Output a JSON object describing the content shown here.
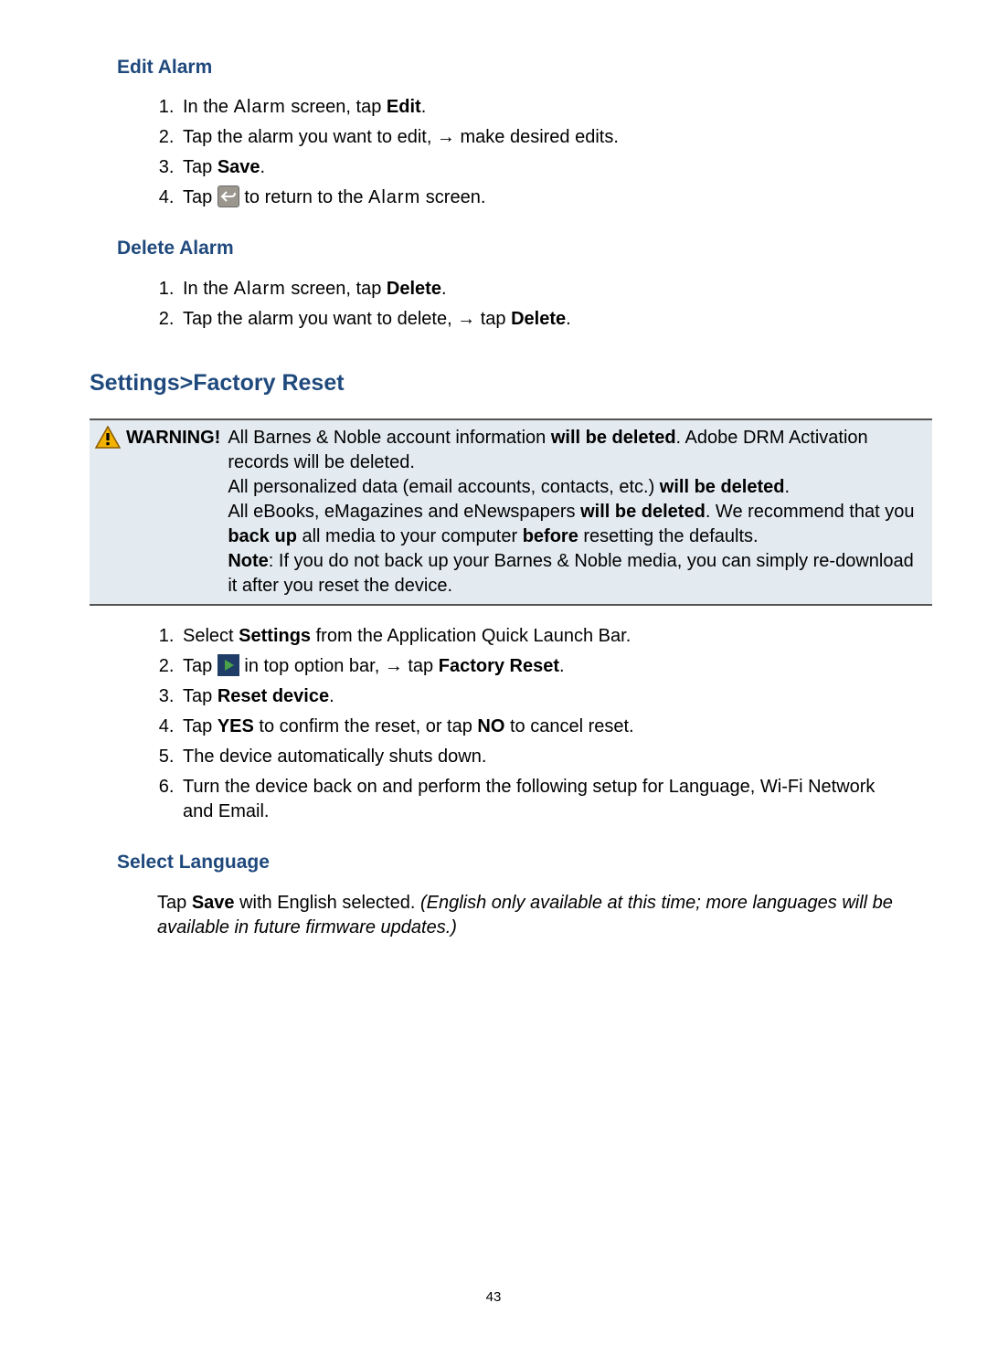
{
  "headings": {
    "editAlarm": "Edit Alarm",
    "deleteAlarm": "Delete Alarm",
    "factoryReset": "Settings>Factory Reset",
    "selectLanguage": "Select Language"
  },
  "editAlarmSteps": {
    "s1_a": "In the ",
    "s1_b": "Alarm",
    "s1_c": " screen, tap ",
    "s1_d": "Edit",
    "s1_e": ".",
    "s2": "Tap the alarm you want to edit, → make desired edits.",
    "s3_a": "Tap ",
    "s3_b": "Save",
    "s3_c": ".",
    "s4_a": "Tap ",
    "s4_b": " to return to the ",
    "s4_c": "Alarm",
    "s4_d": " screen."
  },
  "deleteAlarmSteps": {
    "s1_a": "In the ",
    "s1_b": "Alarm",
    "s1_c": " screen, tap ",
    "s1_d": "Delete",
    "s1_e": ".",
    "s2_a": "Tap the alarm you want to delete, → tap ",
    "s2_b": "Delete",
    "s2_c": "."
  },
  "warning": {
    "label": "WARNING!",
    "l1_a": "All Barnes & Noble account information ",
    "l1_b": "will be deleted",
    "l1_c": ". Adobe DRM Activation records will be deleted.",
    "l2_a": "All personalized data (email accounts, contacts, etc.) ",
    "l2_b": "will be deleted",
    "l2_c": ".",
    "l3_a": "All eBooks, eMagazines and eNewspapers ",
    "l3_b": "will be deleted",
    "l3_c": ". We recommend that you ",
    "l3_d": "back up",
    "l3_e": " all media to your computer ",
    "l3_f": "before",
    "l3_g": " resetting the defaults.",
    "l4_a": "Note",
    "l4_b": ": If you do not back up your Barnes & Noble media, you can simply re-download it after you reset the device."
  },
  "factorySteps": {
    "s1_a": "Select ",
    "s1_b": "Settings",
    "s1_c": " from the Application Quick Launch Bar.",
    "s2_a": "Tap ",
    "s2_b": " in top option bar, → tap ",
    "s2_c": "Factory Reset",
    "s2_d": ".",
    "s3_a": "Tap ",
    "s3_b": "Reset device",
    "s3_c": ".",
    "s4_a": "Tap ",
    "s4_b": "YES",
    "s4_c": " to confirm the reset, or tap ",
    "s4_d": "NO",
    "s4_e": " to cancel reset.",
    "s5": "The device automatically shuts down.",
    "s6": "Turn the device back on and perform the following setup for Language, Wi-Fi Network and Email."
  },
  "selectLanguage": {
    "a": "Tap ",
    "b": "Save",
    "c": " with English selected. ",
    "d": "(English only available at this time; more languages will be available in future firmware updates.)"
  },
  "pageNumber": "43"
}
